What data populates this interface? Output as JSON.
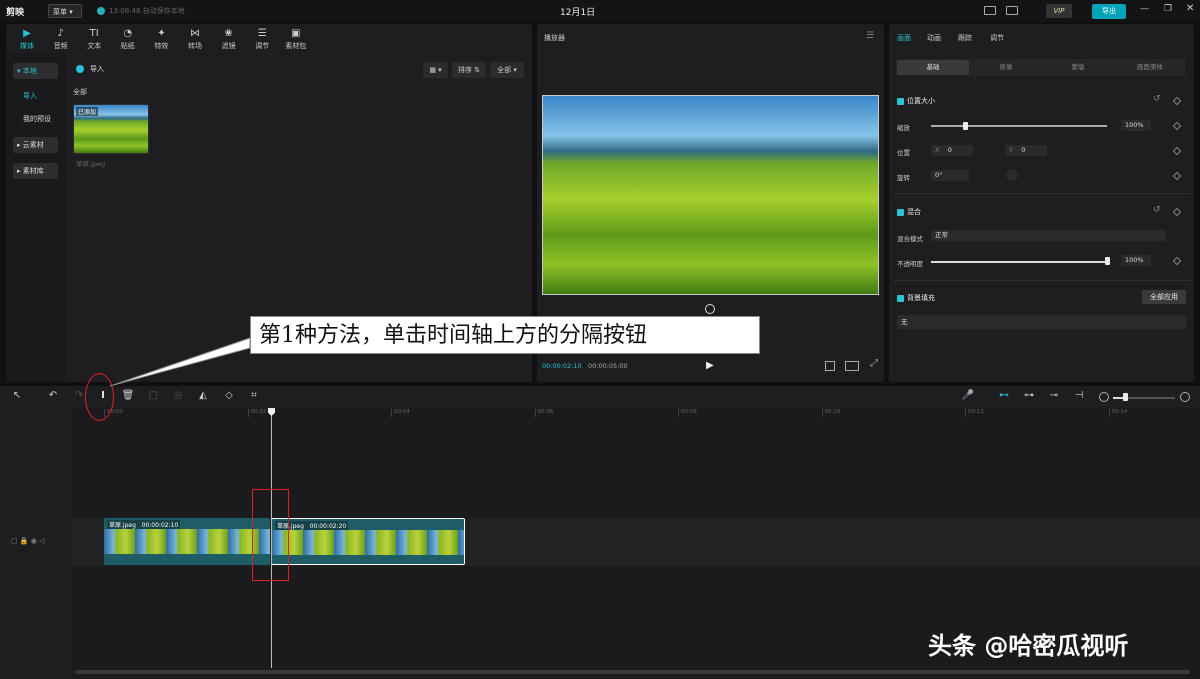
{
  "titlebar": {
    "app_name": "剪映",
    "menu_label": "菜单",
    "save_status": "13:08:48 自动保存本地",
    "title": "12月1日",
    "vip": "VIP",
    "export": "导出"
  },
  "media_tabs": [
    {
      "label": "媒体",
      "icon": "▶"
    },
    {
      "label": "音频",
      "icon": "♪"
    },
    {
      "label": "文本",
      "icon": "TI"
    },
    {
      "label": "贴纸",
      "icon": "◔"
    },
    {
      "label": "特效",
      "icon": "✦"
    },
    {
      "label": "转场",
      "icon": "⋈"
    },
    {
      "label": "滤镜",
      "icon": "❀"
    },
    {
      "label": "调节",
      "icon": "☰"
    },
    {
      "label": "素材包",
      "icon": "▣"
    }
  ],
  "sidebar": {
    "local": "▾ 本地",
    "import": "导入",
    "presets": "我的预设",
    "cloud": "▸ 云素材",
    "library": "▸ 素材库"
  },
  "media": {
    "import_label": "导入",
    "sort_label": "排序 ⇅",
    "all_label": "全部 ▾",
    "section_all": "全部",
    "added_badge": "已添加",
    "file_name": "草原.jpeg"
  },
  "player": {
    "title": "播放器",
    "current_time": "00:00:02:10",
    "total_time": "00:00:05:00"
  },
  "props": {
    "tabs": [
      "画面",
      "动画",
      "跟踪",
      "调节"
    ],
    "subtabs": [
      "基础",
      "抠像",
      "蒙版",
      "画面美体"
    ],
    "position_size": "位置大小",
    "scale_label": "缩放",
    "scale_value": "100%",
    "position_label": "位置",
    "x_label": "X",
    "x_value": "0",
    "y_label": "Y",
    "y_value": "0",
    "rotate_label": "旋转",
    "rotate_value": "0°",
    "blend": "混合",
    "blend_mode_label": "混合模式",
    "blend_mode_value": "正常",
    "opacity_label": "不透明度",
    "opacity_value": "100%",
    "bg_fill": "背景填充",
    "apply_all": "全部应用",
    "bg_value": "无"
  },
  "callout": "第1种方法，单击时间轴上方的分隔按钮",
  "timeline": {
    "ticks": [
      "00:00",
      "00:02",
      "00:04",
      "00:06",
      "00:08",
      "00:10",
      "00:12",
      "00:14"
    ],
    "clip1": {
      "name": "草原.jpeg",
      "duration": "00:00:02:10"
    },
    "clip2": {
      "name": "草原.jpeg",
      "duration": "00:00:02:20"
    },
    "cover": "封面"
  },
  "watermark": "头条 @哈密瓜视听",
  "colors": {
    "accent": "#29c5d5",
    "export": "#00a3b8",
    "highlight": "#e02020"
  }
}
